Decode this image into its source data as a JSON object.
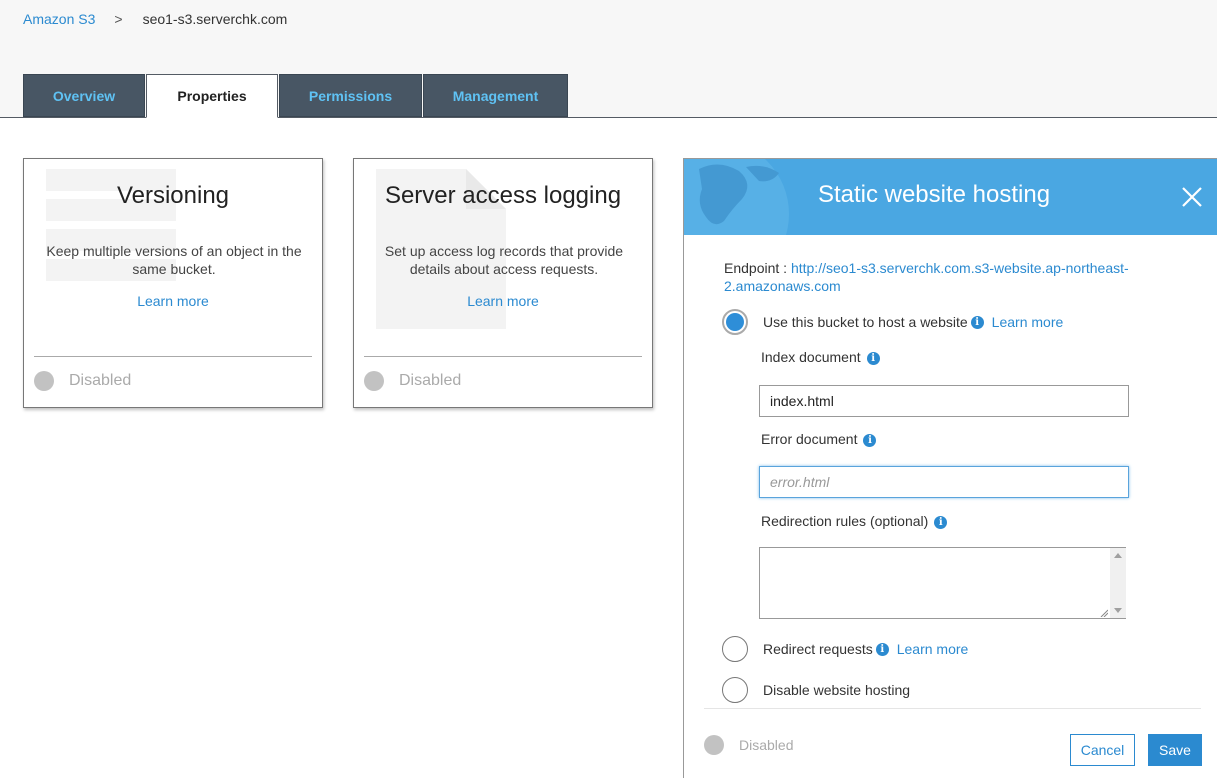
{
  "breadcrumb": {
    "root": "Amazon S3",
    "separator": ">",
    "current": "seo1-s3.serverchk.com"
  },
  "tabs": [
    {
      "label": "Overview",
      "active": false
    },
    {
      "label": "Properties",
      "active": true
    },
    {
      "label": "Permissions",
      "active": false
    },
    {
      "label": "Management",
      "active": false
    }
  ],
  "cards": [
    {
      "title": "Versioning",
      "description": "Keep multiple versions of an object in the same bucket.",
      "learn_more": "Learn more",
      "status": "Disabled"
    },
    {
      "title": "Server access logging",
      "description": "Set up access log records that provide details about access requests.",
      "learn_more": "Learn more",
      "status": "Disabled"
    }
  ],
  "panel": {
    "title": "Static website hosting",
    "close_icon": "close-icon",
    "endpoint_label": "Endpoint :",
    "endpoint_url": "http://seo1-s3.serverchk.com.s3-website.ap-northeast-2.amazonaws.com",
    "option_host": "Use this bucket to host a website",
    "option_host_learn": "Learn more",
    "index_label": "Index document",
    "index_value": "index.html",
    "error_label": "Error document",
    "error_placeholder": "error.html",
    "redirection_label": "Redirection rules (optional)",
    "redirection_value": "",
    "option_redirect": "Redirect requests",
    "option_redirect_learn": "Learn more",
    "option_disable": "Disable website hosting",
    "status": "Disabled",
    "cancel_label": "Cancel",
    "save_label": "Save",
    "colors": {
      "header": "#4aa7e2",
      "link": "#2b8ad0",
      "tab_bg": "#485664",
      "tab_text": "#5fc2f4"
    }
  }
}
